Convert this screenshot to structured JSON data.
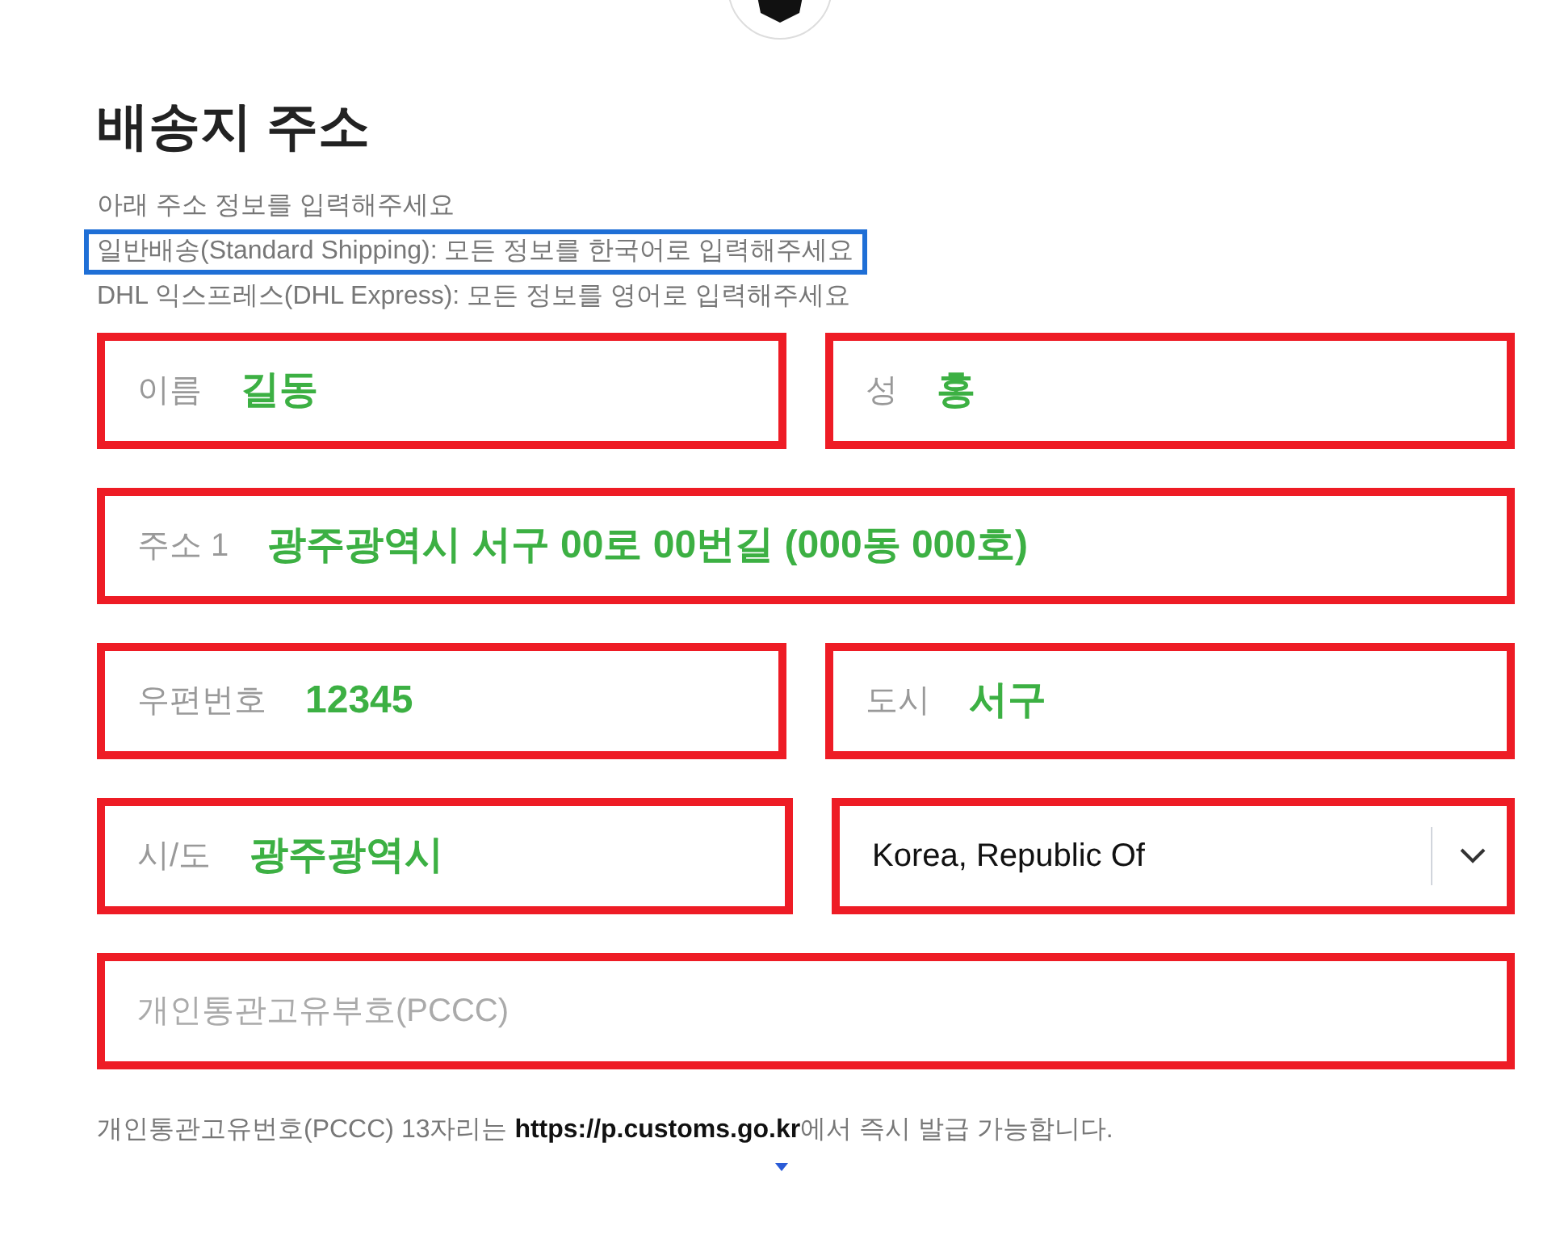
{
  "title": "배송지 주소",
  "notes": [
    {
      "text": "아래 주소 정보를 입력해주세요",
      "highlighted": false
    },
    {
      "text": "일반배송(Standard Shipping): 모든 정보를 한국어로 입력해주세요",
      "highlighted": true
    },
    {
      "text": "DHL 익스프레스(DHL Express): 모든 정보를 영어로 입력해주세요",
      "highlighted": false
    }
  ],
  "rows": [
    [
      {
        "kind": "text",
        "label": "이름",
        "value": "길동"
      },
      {
        "kind": "text",
        "label": "성",
        "value": "홍"
      }
    ],
    [
      {
        "kind": "text",
        "label": "주소 1",
        "value": "광주광역시 서구 00로 00번길 (000동 000호)"
      }
    ],
    [
      {
        "kind": "text",
        "label": "우편번호",
        "value": "12345"
      },
      {
        "kind": "text",
        "label": "도시",
        "value": "서구"
      }
    ],
    [
      {
        "kind": "text",
        "label": "시/도",
        "value": "광주광역시"
      },
      {
        "kind": "select",
        "value": "Korea, Republic Of"
      }
    ],
    [
      {
        "kind": "placeholder",
        "placeholder": "개인통관고유부호(PCCC)"
      }
    ]
  ],
  "footer": "개인통관고유번호(PCCC) 13자리는 **https://p.customs.go.kr**에서 즉시 발급 가능합니다."
}
